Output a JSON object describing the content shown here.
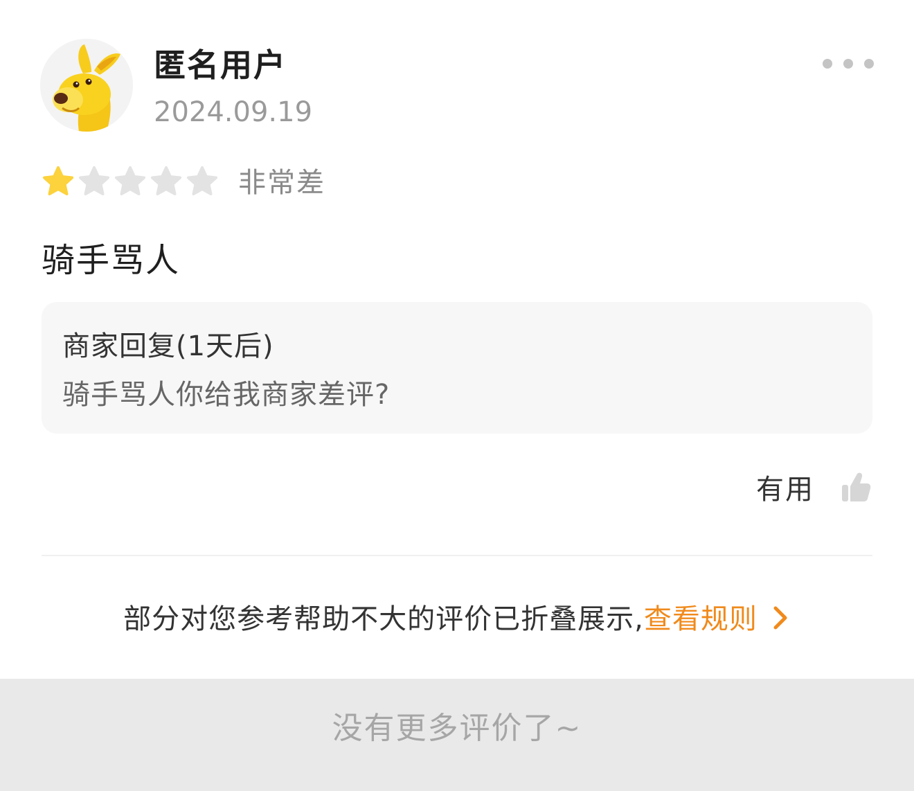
{
  "user": {
    "name": "匿名用户",
    "date": "2024.09.19",
    "avatar_icon": "yellow-kangaroo-mascot-icon"
  },
  "rating": {
    "stars_filled": 1,
    "stars_total": 5,
    "label": "非常差",
    "filled_color": "#fcd23d",
    "empty_color": "#e3e3e3"
  },
  "review": {
    "text": "骑手骂人"
  },
  "merchant_reply": {
    "title": "商家回复(1天后)",
    "text": "骑手骂人你给我商家差评?"
  },
  "actions": {
    "more_icon": "more-dots-icon",
    "useful_label": "有用",
    "useful_icon": "thumbs-up-icon"
  },
  "folded_notice": {
    "text": "部分对您参考帮助不大的评价已折叠展示,",
    "link_label": "查看规则",
    "link_color": "#f08a1c"
  },
  "footer": {
    "text": "没有更多评价了~"
  }
}
